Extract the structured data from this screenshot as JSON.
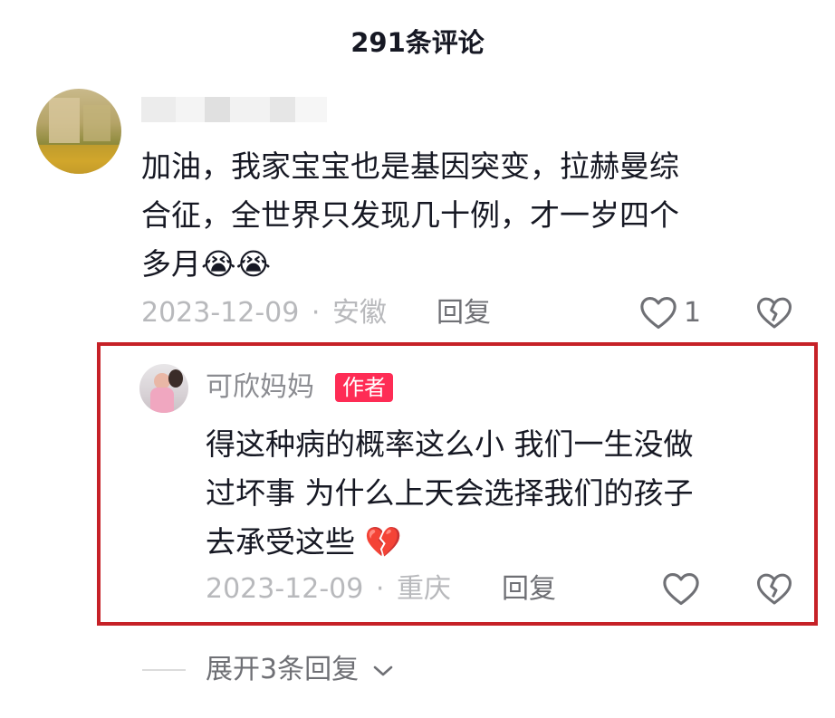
{
  "header": {
    "title": "291条评论"
  },
  "comment": {
    "text_lines": [
      "加油，我家宝宝也是基因突变，拉赫曼综",
      "合征，全世界只发现几十例，才一岁四个",
      "多月"
    ],
    "emoji": "😭😭",
    "date": "2023-12-09",
    "sep": "·",
    "location": "安徽",
    "reply_label": "回复",
    "like_count": "1"
  },
  "reply": {
    "username": "可欣妈妈",
    "author_badge": "作者",
    "text_lines": [
      "得这种病的概率这么小 我们一生没做",
      "过坏事 为什么上天会选择我们的孩子",
      "去承受这些"
    ],
    "emoji": "💔",
    "date": "2023-12-09",
    "sep": "·",
    "location": "重庆",
    "reply_label": "回复"
  },
  "expand": {
    "label": "展开3条回复"
  },
  "colors": {
    "author_badge": "#fe2c55",
    "highlight_border": "#c62127",
    "meta_gray": "#b8b9bc"
  },
  "icons": [
    "heart-outline-icon",
    "broken-heart-icon",
    "chevron-down-icon"
  ]
}
